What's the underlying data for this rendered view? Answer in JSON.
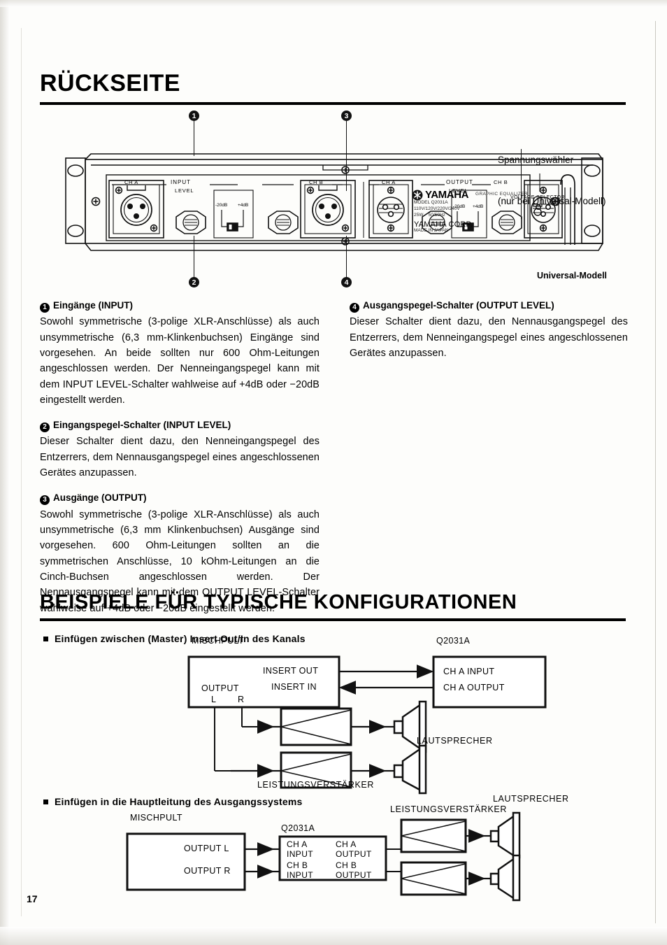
{
  "page": {
    "number": "17",
    "heading_main": "RÜCKSEITE",
    "heading_examples": "BEISPIELE FÜR TYPISCHE KONFIGURATIONEN"
  },
  "panel": {
    "voltage_note_line1": "Spannungswähler",
    "voltage_note_line2": "(nur bei Universal-Modell)",
    "universal_model_label": "Universal-Modell",
    "callouts": [
      "1",
      "2",
      "3",
      "4"
    ],
    "input_group_label": "INPUT",
    "input_level_label": "LEVEL",
    "input_ch_a": "CH A",
    "input_ch_b": "CH B",
    "output_group_label": "OUTPUT",
    "output_level_label": "LEVEL",
    "output_ch_a": "CH A",
    "output_ch_b": "CH B",
    "switch_low": "-20dB",
    "switch_high": "+4dB",
    "voltage_selector_label": "VOLTAGE SELECTOR",
    "brand": "YAMAHA",
    "brand_sub": "GRAPHIC EQUALIZER",
    "plate_model": "MODEL Q2031A",
    "plate_voltage": "110V/120V/220V/240V",
    "plate_power": "25W    50/60Hz",
    "plate_corp": "YAMAHA CORP.",
    "plate_origin": "MADE IN JAPAN"
  },
  "sections": {
    "left": [
      {
        "num": "1",
        "title": "Eingänge (INPUT)",
        "body": "Sowohl symmetrische (3-polige XLR-Anschlüsse) als auch unsymmetrische (6,3 mm-Klinkenbuchsen) Eingänge sind vorgesehen. An beide sollten nur 600 Ohm-Leitungen angeschlossen werden. Der Nenneingangspegel kann mit dem INPUT LEVEL-Schalter wahlweise auf +4dB oder −20dB eingestellt werden."
      },
      {
        "num": "2",
        "title": "Eingangspegel-Schalter (INPUT LEVEL)",
        "body": "Dieser Schalter dient dazu, den Nenneingangspegel des Entzerrers, dem Nennausgangspegel eines angeschlossenen Gerätes anzupassen."
      },
      {
        "num": "3",
        "title": "Ausgänge (OUTPUT)",
        "body": "Sowohl symmetrische (3-polige XLR-Anschlüsse) als auch unsymmetrische (6,3 mm Klinkenbuchsen) Ausgänge sind vorgesehen. 600 Ohm-Leitungen sollten an die symmetrischen Anschlüsse, 10 kOhm-Leitungen an die Cinch-Buchsen angeschlossen werden. Der Nennausgangspegel kann mit dem OUTPUT LEVEL-Schalter wahlweise auf +4dB oder −20dB eingestellt werden."
      }
    ],
    "right": [
      {
        "num": "4",
        "title": "Ausgangspegel-Schalter (OUTPUT LEVEL)",
        "body": "Dieser Schalter dient dazu, den Nennausgangspegel des Entzerrers, dem Nenneingangspegel eines angeschlossenen Gerätes anzupassen."
      }
    ]
  },
  "diagram1": {
    "subhead": "Einfügen zwischen (Master) Insert Out/In des Kanals",
    "mixer_label": "MISCHPULT",
    "eq_label": "Q2031A",
    "insert_out": "INSERT OUT",
    "insert_in": "INSERT IN",
    "output_label": "OUTPUT",
    "output_l": "L",
    "output_r": "R",
    "ch_a_input": "CH A INPUT",
    "ch_a_output": "CH A OUTPUT",
    "amp_label": "LEISTUNGSVERSTÄRKER",
    "speaker_label": "LAUTSPRECHER"
  },
  "diagram2": {
    "subhead": "Einfügen in die Hauptleitung des Ausgangssystems",
    "mixer_label": "MISCHPULT",
    "eq_label": "Q2031A",
    "output_l": "OUTPUT L",
    "output_r": "OUTPUT R",
    "ch_a_input": "CH A\nINPUT",
    "ch_b_input": "CH B\nINPUT",
    "ch_a_output": "CH A\nOUTPUT",
    "ch_b_output": "CH B\nOUTPUT",
    "amp_label": "LEISTUNGSVERSTÄRKER",
    "speaker_label": "LAUTSPRECHER"
  }
}
